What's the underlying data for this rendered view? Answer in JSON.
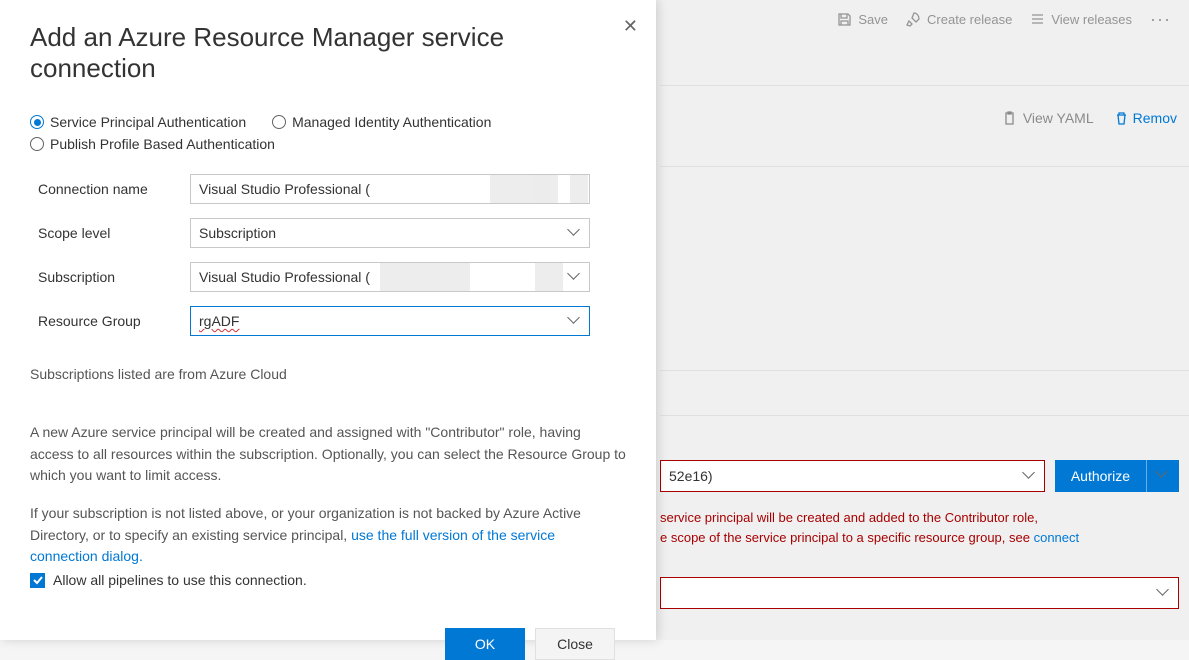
{
  "toolbar": {
    "save": "Save",
    "create_release": "Create release",
    "view_releases": "View releases",
    "more": "···"
  },
  "actions": {
    "view_yaml": "View YAML",
    "remove": "Remov"
  },
  "background": {
    "subscription_suffix": "52e16)",
    "authorize": "Authorize",
    "warning_line1": "service principal will be created and added to the Contributor role,",
    "warning_line2_a": "e scope of the service principal to a specific resource group, see ",
    "warning_link": "connect"
  },
  "dialog": {
    "title": "Add an Azure Resource Manager service connection",
    "auth_modes": {
      "sp": "Service Principal Authentication",
      "mi": "Managed Identity Authentication",
      "pp": "Publish Profile Based Authentication"
    },
    "labels": {
      "connection_name": "Connection name",
      "scope_level": "Scope level",
      "subscription": "Subscription",
      "resource_group": "Resource Group"
    },
    "values": {
      "connection_name": "Visual Studio Professional (",
      "scope_level": "Subscription",
      "subscription": "Visual Studio Professional (",
      "resource_group": "rgADF"
    },
    "note": "Subscriptions listed are from Azure Cloud",
    "desc1": "A new Azure service principal will be created and assigned with \"Contributor\" role, having access to all resources within the subscription. Optionally, you can select the Resource Group to which you want to limit access.",
    "desc2_a": "If your subscription is not listed above, or your organization is not backed by Azure Active Directory, or to specify an existing service principal, ",
    "desc2_link": "use the full version of the service connection dialog.",
    "allow_all": "Allow all pipelines to use this connection.",
    "ok": "OK",
    "close": "Close"
  }
}
